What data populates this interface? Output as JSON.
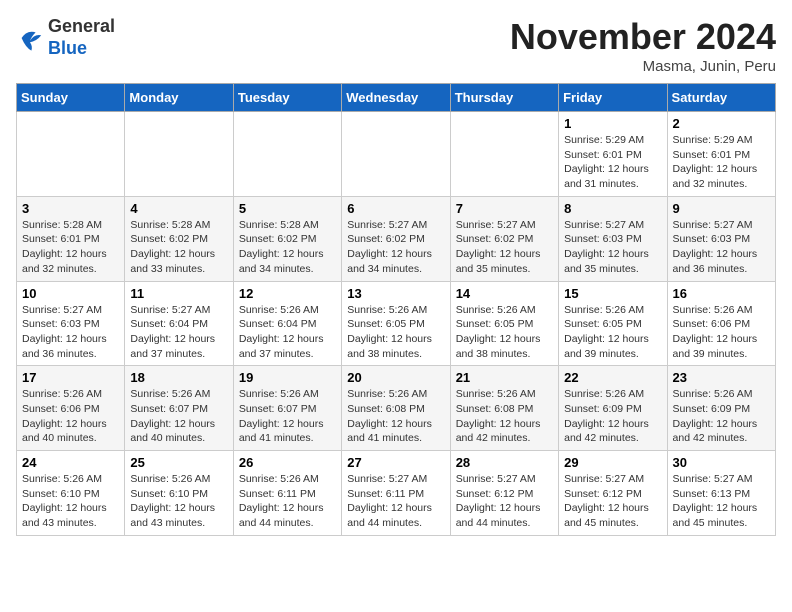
{
  "header": {
    "logo_general": "General",
    "logo_blue": "Blue",
    "month_title": "November 2024",
    "location": "Masma, Junin, Peru"
  },
  "days_of_week": [
    "Sunday",
    "Monday",
    "Tuesday",
    "Wednesday",
    "Thursday",
    "Friday",
    "Saturday"
  ],
  "weeks": [
    [
      {
        "day": "",
        "info": ""
      },
      {
        "day": "",
        "info": ""
      },
      {
        "day": "",
        "info": ""
      },
      {
        "day": "",
        "info": ""
      },
      {
        "day": "",
        "info": ""
      },
      {
        "day": "1",
        "info": "Sunrise: 5:29 AM\nSunset: 6:01 PM\nDaylight: 12 hours and 31 minutes."
      },
      {
        "day": "2",
        "info": "Sunrise: 5:29 AM\nSunset: 6:01 PM\nDaylight: 12 hours and 32 minutes."
      }
    ],
    [
      {
        "day": "3",
        "info": "Sunrise: 5:28 AM\nSunset: 6:01 PM\nDaylight: 12 hours and 32 minutes."
      },
      {
        "day": "4",
        "info": "Sunrise: 5:28 AM\nSunset: 6:02 PM\nDaylight: 12 hours and 33 minutes."
      },
      {
        "day": "5",
        "info": "Sunrise: 5:28 AM\nSunset: 6:02 PM\nDaylight: 12 hours and 34 minutes."
      },
      {
        "day": "6",
        "info": "Sunrise: 5:27 AM\nSunset: 6:02 PM\nDaylight: 12 hours and 34 minutes."
      },
      {
        "day": "7",
        "info": "Sunrise: 5:27 AM\nSunset: 6:02 PM\nDaylight: 12 hours and 35 minutes."
      },
      {
        "day": "8",
        "info": "Sunrise: 5:27 AM\nSunset: 6:03 PM\nDaylight: 12 hours and 35 minutes."
      },
      {
        "day": "9",
        "info": "Sunrise: 5:27 AM\nSunset: 6:03 PM\nDaylight: 12 hours and 36 minutes."
      }
    ],
    [
      {
        "day": "10",
        "info": "Sunrise: 5:27 AM\nSunset: 6:03 PM\nDaylight: 12 hours and 36 minutes."
      },
      {
        "day": "11",
        "info": "Sunrise: 5:27 AM\nSunset: 6:04 PM\nDaylight: 12 hours and 37 minutes."
      },
      {
        "day": "12",
        "info": "Sunrise: 5:26 AM\nSunset: 6:04 PM\nDaylight: 12 hours and 37 minutes."
      },
      {
        "day": "13",
        "info": "Sunrise: 5:26 AM\nSunset: 6:05 PM\nDaylight: 12 hours and 38 minutes."
      },
      {
        "day": "14",
        "info": "Sunrise: 5:26 AM\nSunset: 6:05 PM\nDaylight: 12 hours and 38 minutes."
      },
      {
        "day": "15",
        "info": "Sunrise: 5:26 AM\nSunset: 6:05 PM\nDaylight: 12 hours and 39 minutes."
      },
      {
        "day": "16",
        "info": "Sunrise: 5:26 AM\nSunset: 6:06 PM\nDaylight: 12 hours and 39 minutes."
      }
    ],
    [
      {
        "day": "17",
        "info": "Sunrise: 5:26 AM\nSunset: 6:06 PM\nDaylight: 12 hours and 40 minutes."
      },
      {
        "day": "18",
        "info": "Sunrise: 5:26 AM\nSunset: 6:07 PM\nDaylight: 12 hours and 40 minutes."
      },
      {
        "day": "19",
        "info": "Sunrise: 5:26 AM\nSunset: 6:07 PM\nDaylight: 12 hours and 41 minutes."
      },
      {
        "day": "20",
        "info": "Sunrise: 5:26 AM\nSunset: 6:08 PM\nDaylight: 12 hours and 41 minutes."
      },
      {
        "day": "21",
        "info": "Sunrise: 5:26 AM\nSunset: 6:08 PM\nDaylight: 12 hours and 42 minutes."
      },
      {
        "day": "22",
        "info": "Sunrise: 5:26 AM\nSunset: 6:09 PM\nDaylight: 12 hours and 42 minutes."
      },
      {
        "day": "23",
        "info": "Sunrise: 5:26 AM\nSunset: 6:09 PM\nDaylight: 12 hours and 42 minutes."
      }
    ],
    [
      {
        "day": "24",
        "info": "Sunrise: 5:26 AM\nSunset: 6:10 PM\nDaylight: 12 hours and 43 minutes."
      },
      {
        "day": "25",
        "info": "Sunrise: 5:26 AM\nSunset: 6:10 PM\nDaylight: 12 hours and 43 minutes."
      },
      {
        "day": "26",
        "info": "Sunrise: 5:26 AM\nSunset: 6:11 PM\nDaylight: 12 hours and 44 minutes."
      },
      {
        "day": "27",
        "info": "Sunrise: 5:27 AM\nSunset: 6:11 PM\nDaylight: 12 hours and 44 minutes."
      },
      {
        "day": "28",
        "info": "Sunrise: 5:27 AM\nSunset: 6:12 PM\nDaylight: 12 hours and 44 minutes."
      },
      {
        "day": "29",
        "info": "Sunrise: 5:27 AM\nSunset: 6:12 PM\nDaylight: 12 hours and 45 minutes."
      },
      {
        "day": "30",
        "info": "Sunrise: 5:27 AM\nSunset: 6:13 PM\nDaylight: 12 hours and 45 minutes."
      }
    ]
  ]
}
